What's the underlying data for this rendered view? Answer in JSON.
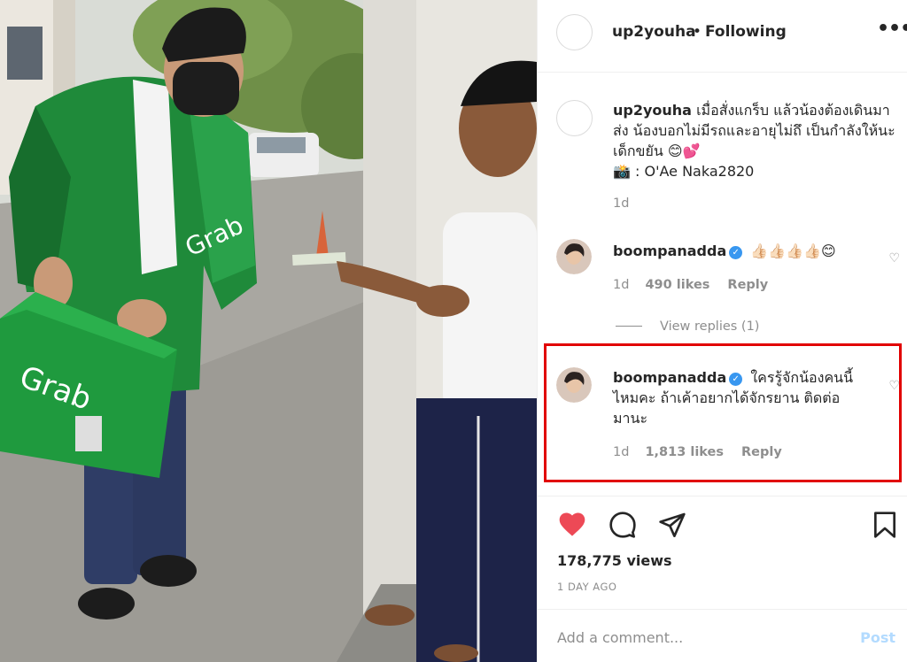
{
  "post": {
    "username": "up2youha",
    "separator": "•",
    "follow_status": "Following",
    "more_icon": "•••"
  },
  "caption": {
    "username": "up2youha",
    "text": "เมื่อสั่งแกร็บ แล้วน้องต้องเดินมาส่ง น้องบอกไม่มีรถและอายุไม่ถึ เป็นกำลังให้นะ เด็กขยัน 😊💕",
    "credit_icon": "📸",
    "credit": ": O'Ae Naka2820",
    "time": "1d"
  },
  "comments": [
    {
      "username": "boompanadda",
      "text": "👍🏻👍🏻👍🏻👍🏻😊",
      "time": "1d",
      "likes": "490 likes",
      "reply_label": "Reply"
    },
    {
      "username": "boompanadda",
      "text": "ใครรู้จักน้องคนนี้ไหมคะ ถ้าเค้าอยากได้จักรยาน ติดต่อมานะ",
      "time": "1d",
      "likes": "1,813 likes",
      "reply_label": "Reply"
    }
  ],
  "view_replies": "View replies (1)",
  "stats": {
    "views": "178,775 views",
    "posted": "1 DAY AGO"
  },
  "add_comment": {
    "placeholder": "Add a comment...",
    "post_label": "Post"
  },
  "media_text": {
    "jacket_logo": "Grab",
    "bag_logo": "Grab"
  },
  "colors": {
    "like_red": "#ed4956",
    "verified_blue": "#3897f0",
    "highlight_red": "#e10000",
    "grab_green": "#1f9a3e"
  }
}
